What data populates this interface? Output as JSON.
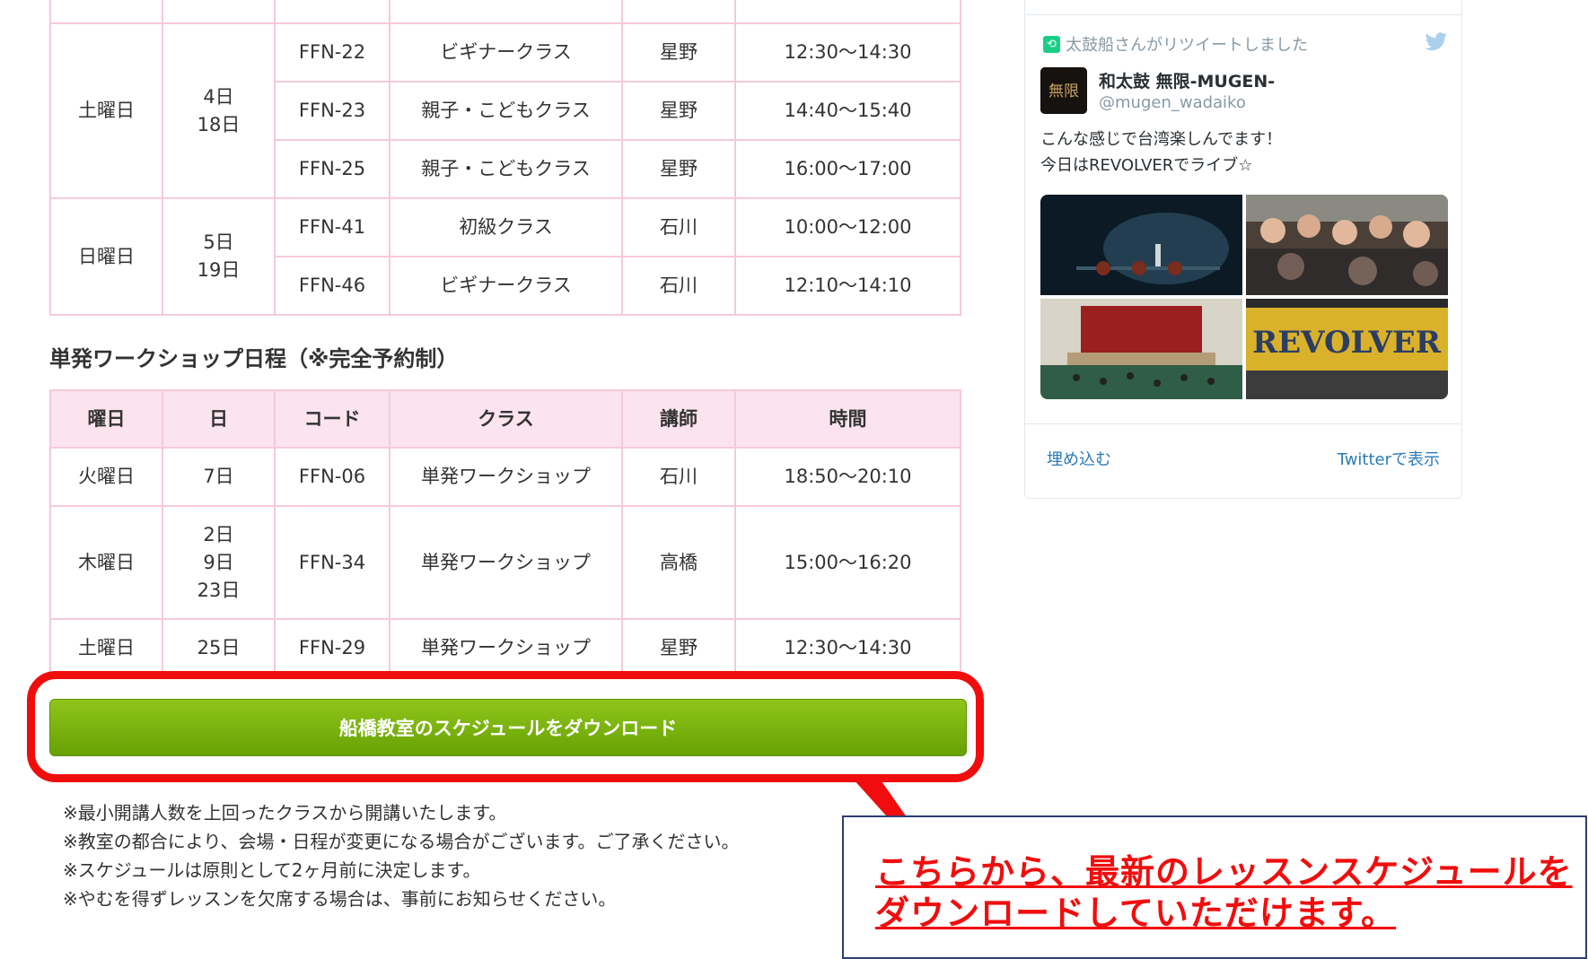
{
  "regular_schedule": {
    "rows": [
      {
        "day": "",
        "dates": "",
        "code": "",
        "class": "",
        "teacher": "",
        "time": ""
      },
      {
        "day": "土曜日",
        "dates": "4日\n18日",
        "code": "FFN-22",
        "class": "ビギナークラス",
        "teacher": "星野",
        "time": "12:30〜14:30"
      },
      {
        "code": "FFN-23",
        "class": "親子・こどもクラス",
        "teacher": "星野",
        "time": "14:40〜15:40"
      },
      {
        "code": "FFN-25",
        "class": "親子・こどもクラス",
        "teacher": "星野",
        "time": "16:00〜17:00"
      },
      {
        "day": "日曜日",
        "dates": "5日\n19日",
        "code": "FFN-41",
        "class": "初級クラス",
        "teacher": "石川",
        "time": "10:00〜12:00"
      },
      {
        "code": "FFN-46",
        "class": "ビギナークラス",
        "teacher": "石川",
        "time": "12:10〜14:10"
      }
    ]
  },
  "workshop": {
    "title": "単発ワークショップ日程（※完全予約制）",
    "headers": {
      "day": "曜日",
      "date": "日",
      "code": "コード",
      "class": "クラス",
      "teacher": "講師",
      "time": "時間"
    },
    "rows": [
      {
        "day": "火曜日",
        "dates": "7日",
        "code": "FFN-06",
        "class": "単発ワークショップ",
        "teacher": "石川",
        "time": "18:50〜20:10"
      },
      {
        "day": "木曜日",
        "dates": "2日\n9日\n23日",
        "code": "FFN-34",
        "class": "単発ワークショップ",
        "teacher": "高橋",
        "time": "15:00〜16:20"
      },
      {
        "day": "土曜日",
        "dates": "25日",
        "code": "FFN-29",
        "class": "単発ワークショップ",
        "teacher": "星野",
        "time": "12:30〜14:30"
      }
    ]
  },
  "download_button": {
    "label": "船橋教室のスケジュールをダウンロード"
  },
  "notes": [
    "※最小開講人数を上回ったクラスから開講いたします。",
    "※教室の都合により、会場・日程が変更になる場合がございます。ご了承ください。",
    "※スケジュールは原則として2ヶ月前に決定します。",
    "※やむを得ずレッスンを欠席する場合は、事前にお知らせください。"
  ],
  "callout": {
    "line1": "こちらから、最新のレッスンスケジュールを",
    "line2": "ダウンロードしていただけます。"
  },
  "tweet": {
    "retweet_label": "太鼓船さんがリツイートしました",
    "name": "和太鼓 無限-MUGEN-",
    "handle": "@mugen_wadaiko",
    "text_line1": "こんな感じで台湾楽しんでます！",
    "text_line2": "今日はREVOLVERでライブ☆",
    "embed_label": "埋め込む",
    "view_label": "Twitterで表示",
    "photo4_text": "REVOLVER",
    "avatar_text": "無限"
  },
  "colors": {
    "accent_red": "#f10d0d",
    "button_green": "#7ab30f",
    "table_border": "#f6c9dc",
    "table_header_bg": "#fbe4ee",
    "twitter_blue": "#2b7bb9"
  }
}
